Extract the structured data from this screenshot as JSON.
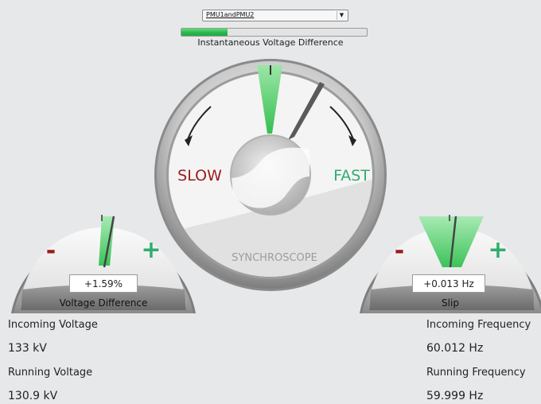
{
  "selector": {
    "value": "PMU1andPMU2",
    "arrow_icon": "dropdown-arrow-icon"
  },
  "progress": {
    "fraction": 0.25,
    "label": "Instantaneous Voltage Difference",
    "fill_color": "#2cb54a"
  },
  "synchroscope": {
    "slow_label": "SLOW",
    "fast_label": "FAST",
    "title": "SYNCHROSCOPE",
    "slow_color": "#9b1c1c",
    "fast_color": "#2fae6e"
  },
  "voltage_gauge": {
    "minus": "-",
    "plus": "+",
    "value": "+1.59%",
    "title": "Voltage Difference"
  },
  "slip_gauge": {
    "minus": "-",
    "plus": "+",
    "value": "+0.013 Hz",
    "title": "Slip"
  },
  "left_info": {
    "incoming_label": "Incoming Voltage",
    "incoming_value": "133 kV",
    "running_label": "Running Voltage",
    "running_value": "130.9 kV"
  },
  "right_info": {
    "incoming_label": "Incoming Frequency",
    "incoming_value": "60.012 Hz",
    "running_label": "Running Frequency",
    "running_value": "59.999 Hz"
  },
  "colors": {
    "accent_green": "#3cc35a",
    "minus_red": "#9b1c1c",
    "plus_green": "#2fae6e"
  }
}
